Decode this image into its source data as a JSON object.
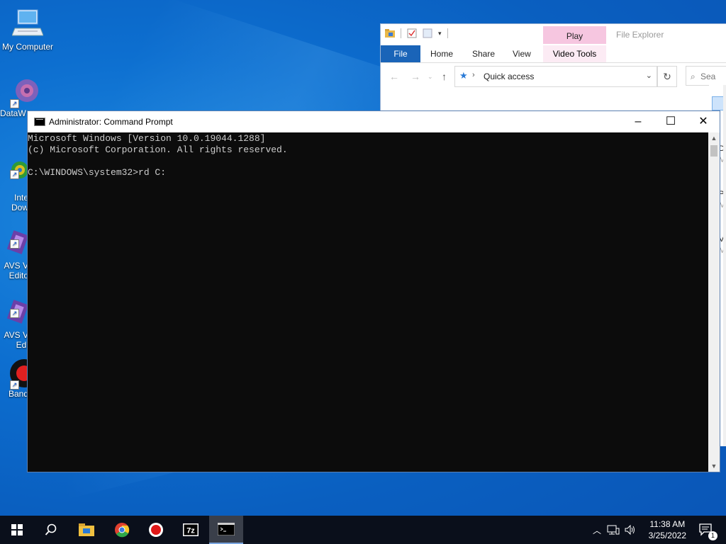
{
  "desktop": {
    "icons": [
      {
        "label": "My Computer"
      },
      {
        "label": "DataW"
      },
      {
        "label": "Inte\nDow"
      },
      {
        "label": "AVS V\nEdito"
      },
      {
        "label": "AVS V\nEdi"
      },
      {
        "label": "Band"
      }
    ]
  },
  "explorer": {
    "title": "File Explorer",
    "context_tab": "Play",
    "ribbon_tabs": [
      "File",
      "Home",
      "Share",
      "View"
    ],
    "context_group": "Video Tools",
    "address": "Quick access",
    "search_placeholder": "Sea",
    "side_fragments": [
      "Do",
      "My",
      "Pic",
      "My",
      "Vic",
      "My"
    ]
  },
  "cmd": {
    "title": "Administrator: Command Prompt",
    "lines": [
      "Microsoft Windows [Version 10.0.19044.1288]",
      "(c) Microsoft Corporation. All rights reserved.",
      "",
      "C:\\WINDOWS\\system32>rd C:"
    ]
  },
  "taskbar": {
    "time": "11:38 AM",
    "date": "3/25/2022",
    "notification_count": "1",
    "apps": [
      "start-icon",
      "search-icon",
      "file-explorer-icon",
      "chrome-icon",
      "record-icon",
      "7zip-icon",
      "cmd-icon"
    ]
  },
  "colors": {
    "accent": "#1a64b8",
    "console_bg": "#0c0c0c",
    "console_fg": "#cccccc",
    "taskbar_bg": "#0a0f1b"
  }
}
